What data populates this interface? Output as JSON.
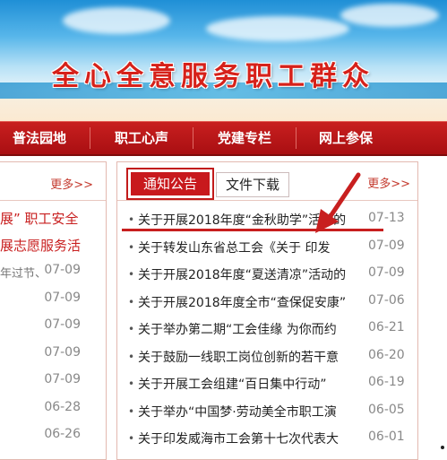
{
  "banner": {
    "slogan": "全心全意服务职工群众"
  },
  "nav": {
    "items": [
      "普法园地",
      "职工心声",
      "党建专栏",
      "网上参保"
    ]
  },
  "left": {
    "more": "更多>>",
    "line1": "展” 职工安全",
    "line2": "展志愿服务活",
    "line3": "年过节、",
    "dates": [
      "07-09",
      "07-09",
      "07-09",
      "07-09",
      "07-09",
      "06-28",
      "06-26"
    ]
  },
  "right": {
    "tabs": [
      "通知公告",
      "文件下载"
    ],
    "more": "更多>>",
    "rows": [
      {
        "title": "关于开展2018年度“金秋助学”活动的",
        "date": "07-13"
      },
      {
        "title": "关于转发山东省总工会《关于 印发",
        "date": "07-09"
      },
      {
        "title": "关于开展2018年度“夏送清凉”活动的",
        "date": "07-09"
      },
      {
        "title": "关于开展2018年度全市“查保促安康”",
        "date": "07-06"
      },
      {
        "title": "关于举办第二期“工会佳缘 为你而约",
        "date": "06-21"
      },
      {
        "title": "关于鼓励一线职工岗位创新的若干意",
        "date": "06-20"
      },
      {
        "title": "关于开展工会组建“百日集中行动”",
        "date": "06-19"
      },
      {
        "title": "关于举办“中国梦·劳动美全市职工演",
        "date": "06-05"
      },
      {
        "title": "关于印发威海市工会第十七次代表大",
        "date": "06-01"
      }
    ]
  }
}
